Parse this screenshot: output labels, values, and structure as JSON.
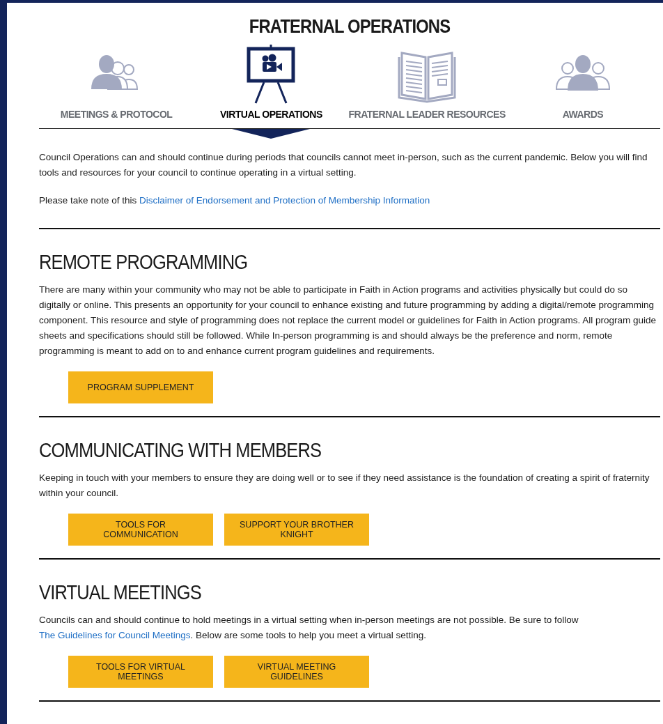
{
  "title": "FRATERNAL OPERATIONS",
  "tabs": [
    {
      "label": "MEETINGS & PROTOCOL",
      "selected": false,
      "kind": "people"
    },
    {
      "label": "VIRTUAL OPERATIONS",
      "selected": true,
      "kind": "screen"
    },
    {
      "label": "FRATERNAL LEADER RESOURCES",
      "selected": false,
      "kind": "book"
    },
    {
      "label": "AWARDS",
      "selected": false,
      "kind": "group"
    }
  ],
  "intro": [
    [
      {
        "kind": "text",
        "text": "Council Operations can and should continue during periods that councils cannot meet in-person, such as the current pandemic. Below you will find tools and resources for your council to continue operating in a virtual setting."
      }
    ],
    [
      {
        "kind": "text",
        "text": "Please take note of this "
      },
      {
        "kind": "link",
        "text": "Disclaimer of Endorsement and Protection of Membership Information"
      }
    ]
  ],
  "sections": [
    {
      "heading": "REMOTE PROGRAMMING",
      "body": [
        {
          "kind": "text",
          "text": "There are many within your community who may not be able to participate in Faith in Action programs and activities physically but could do so digitally or online. This presents an opportunity for your council to enhance existing and future programming by adding a digital/remote programming component. This resource and style of programming does not replace the current model or guidelines for Faith in Action programs. All program guide sheets and specifications should still be followed. While In-person programming is and should always be the preference and norm, remote programming is meant to add on to and enhance current program guidelines and requirements."
        }
      ],
      "buttons": [
        "PROGRAM SUPPLEMENT"
      ]
    },
    {
      "heading": "COMMUNICATING WITH MEMBERS",
      "body": [
        {
          "kind": "text",
          "text": "Keeping in touch with your members to ensure they are doing well or to see if they need assistance is the foundation of creating a spirit of fraternity within your council."
        }
      ],
      "buttons": [
        "TOOLS FOR COMMUNICATION",
        "SUPPORT YOUR BROTHER KNIGHT"
      ]
    },
    {
      "heading": "VIRTUAL MEETINGS",
      "body": [
        {
          "kind": "text",
          "text": "Councils can and should continue to hold meetings in a virtual setting when in-person meetings are not possible. Be sure to follow "
        },
        {
          "kind": "link",
          "text": "The Guidelines for Council Meetings"
        },
        {
          "kind": "text",
          "text": ". Below are some tools to help you meet a virtual setting."
        }
      ],
      "buttons": [
        "TOOLS FOR VIRTUAL MEETINGS",
        "VIRTUAL MEETING GUIDELINES"
      ]
    }
  ]
}
